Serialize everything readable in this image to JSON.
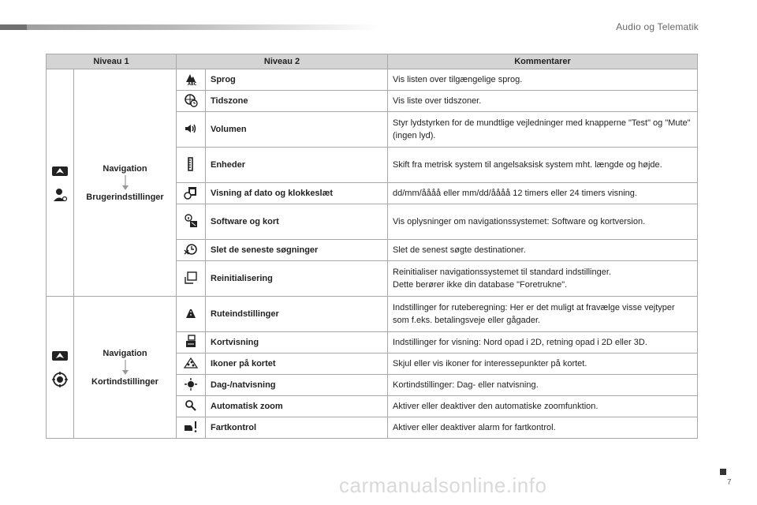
{
  "header": {
    "title": "Audio og Telematik"
  },
  "table": {
    "columns": [
      "Niveau 1",
      "Niveau 2",
      "Kommentarer"
    ],
    "groups": [
      {
        "nav_title": "Navigation",
        "nav_sub": "Brugerindstillinger",
        "side_icons": [
          "navigation-icon",
          "user-settings-icon"
        ],
        "rows": [
          {
            "icon": "language-abc-icon",
            "label": "Sprog",
            "comment": "Vis listen over tilgængelige sprog."
          },
          {
            "icon": "globe-clock-icon",
            "label": "Tidszone",
            "comment": "Vis liste over tidszoner."
          },
          {
            "icon": "speaker-icon",
            "label": "Volumen",
            "comment": "Styr lydstyrken for de mundtlige vejledninger med knapperne \"Test\" og \"Mute\" (ingen lyd)."
          },
          {
            "icon": "ruler-icon",
            "label": "Enheder",
            "comment": "Skift fra metrisk system til angelsaksisk system mht. længde og højde."
          },
          {
            "icon": "calendar-clock-icon",
            "label": "Visning af dato og klokkeslæt",
            "comment": "dd/mm/åååå eller mm/dd/åååå 12 timers eller 24 timers visning."
          },
          {
            "icon": "info-map-icon",
            "label": "Software og kort",
            "comment": "Vis oplysninger om navigationssystemet: Software og kortversion."
          },
          {
            "icon": "history-clear-icon",
            "label": "Slet de seneste søgninger",
            "comment": "Slet de senest søgte destinationer."
          },
          {
            "icon": "reset-icon",
            "label": "Reinitialisering",
            "comment": "Reinitialiser navigationssystemet til standard indstillinger.\nDette berører ikke din database \"Foretrukne\"."
          }
        ]
      },
      {
        "nav_title": "Navigation",
        "nav_sub": "Kortindstillinger",
        "side_icons": [
          "navigation-icon",
          "map-settings-icon"
        ],
        "rows": [
          {
            "icon": "route-icon",
            "label": "Ruteindstillinger",
            "comment": "Indstillinger for ruteberegning: Her er det muligt at fravælge visse vejtyper som f.eks. betalingsveje eller gågader."
          },
          {
            "icon": "map-view-icon",
            "label": "Kortvisning",
            "comment": "Indstillinger for visning: Nord opad i 2D, retning opad i 2D eller 3D."
          },
          {
            "icon": "poi-icon",
            "label": "Ikoner på kortet",
            "comment": "Skjul eller vis ikoner for interessepunkter på kortet."
          },
          {
            "icon": "day-night-icon",
            "label": "Dag-/natvisning",
            "comment": "Kortindstillinger: Dag- eller natvisning."
          },
          {
            "icon": "zoom-icon",
            "label": "Automatisk zoom",
            "comment": "Aktiver eller deaktiver den automatiske zoomfunktion."
          },
          {
            "icon": "speed-alert-icon",
            "label": "Fartkontrol",
            "comment": "Aktiver eller deaktiver alarm for fartkontrol."
          }
        ]
      }
    ]
  },
  "footer": {
    "watermark": "carmanualsonline.info",
    "page_number": "7"
  }
}
